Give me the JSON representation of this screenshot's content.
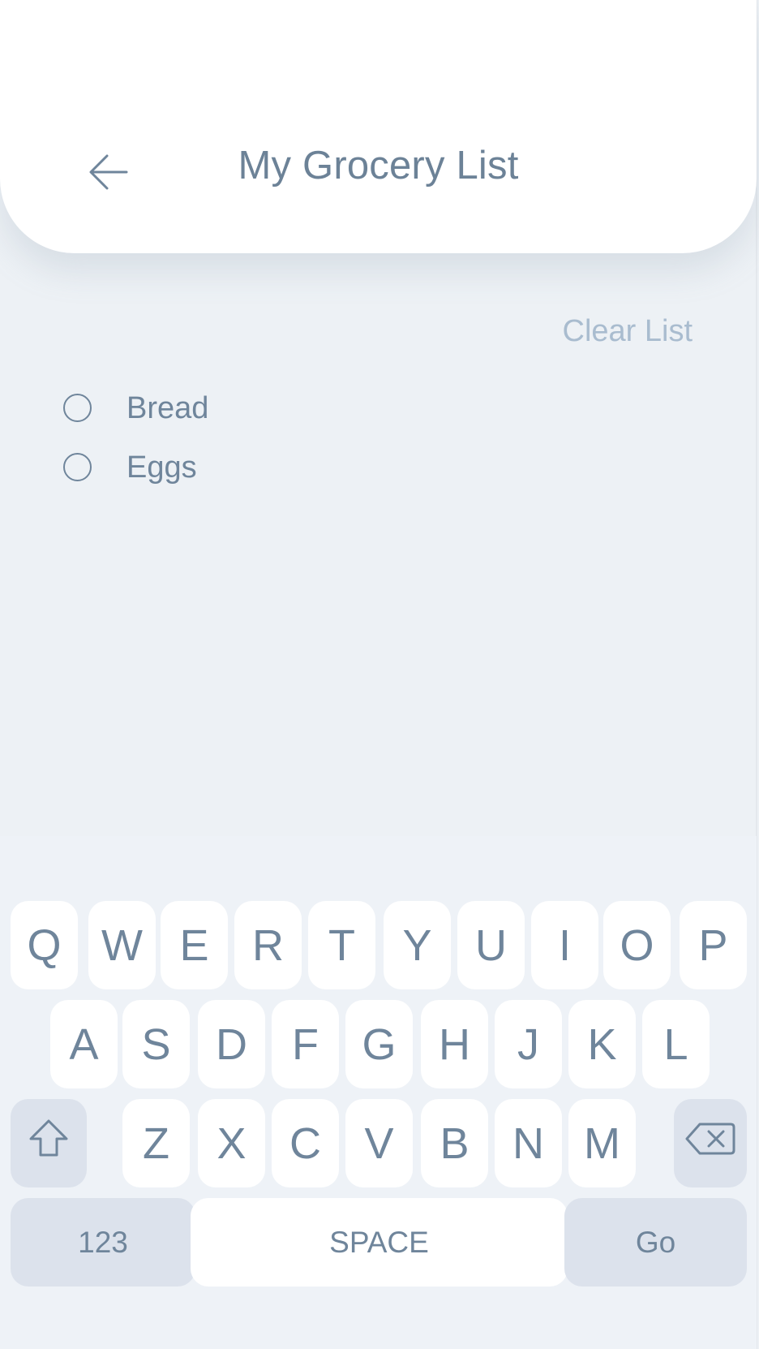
{
  "header": {
    "title": "My Grocery List",
    "back_icon": "arrow-left-icon"
  },
  "list": {
    "clear_label": "Clear List",
    "items": [
      {
        "label": "Bread",
        "checked": false
      },
      {
        "label": "Eggs",
        "checked": false
      }
    ]
  },
  "keyboard": {
    "row1": [
      "Q",
      "W",
      "E",
      "R",
      "T",
      "Y",
      "U",
      "I",
      "O",
      "P"
    ],
    "row2": [
      "A",
      "S",
      "D",
      "F",
      "G",
      "H",
      "J",
      "K",
      "L"
    ],
    "row3": [
      "Z",
      "X",
      "C",
      "V",
      "B",
      "N",
      "M"
    ],
    "shift_icon": "shift-icon",
    "backspace_icon": "backspace-icon",
    "numbers_label": "123",
    "space_label": "SPACE",
    "go_label": "Go"
  },
  "colors": {
    "background": "#edf1f5",
    "text": "#6f859b",
    "muted_text": "#a9bccf",
    "function_key": "#dce2ec",
    "key": "#ffffff"
  }
}
